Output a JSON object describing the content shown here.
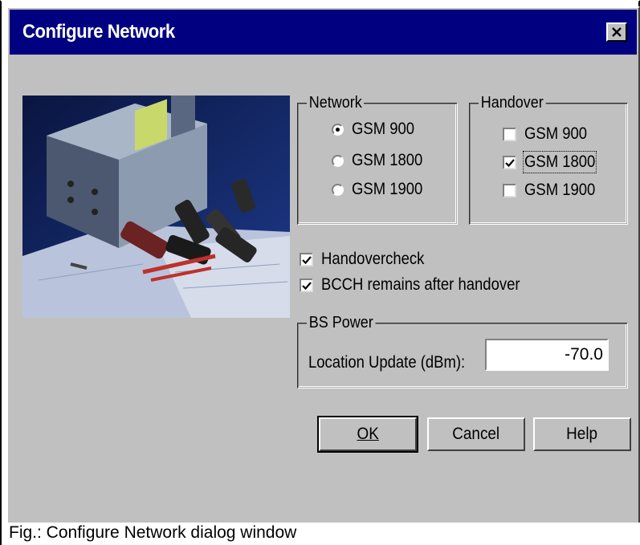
{
  "dialog": {
    "title": "Configure Network",
    "close_symbol": "×"
  },
  "photo": {
    "subject": "GSM test equipment with mobile phones"
  },
  "network_group": {
    "legend": "Network",
    "options": [
      {
        "label": "GSM 900",
        "selected": true
      },
      {
        "label": "GSM 1800",
        "selected": false
      },
      {
        "label": "GSM 1900",
        "selected": false
      }
    ]
  },
  "handover_group": {
    "legend": "Handover",
    "options": [
      {
        "label": "GSM 900",
        "checked": false
      },
      {
        "label": "GSM 1800",
        "checked": true
      },
      {
        "label": "GSM 1900",
        "checked": false
      }
    ]
  },
  "checks": {
    "handovercheck": {
      "label": "Handovercheck",
      "checked": true
    },
    "bcch": {
      "label": "BCCH remains after handover",
      "checked": true
    }
  },
  "bs_power": {
    "legend": "BS Power",
    "field_label": "Location Update (dBm):",
    "value": "-70.0"
  },
  "buttons": {
    "ok": "OK",
    "cancel": "Cancel",
    "help": "Help"
  },
  "caption": "Fig.: Configure Network dialog window",
  "colors": {
    "titlebar": "#000080",
    "face": "#c0c0c0"
  }
}
